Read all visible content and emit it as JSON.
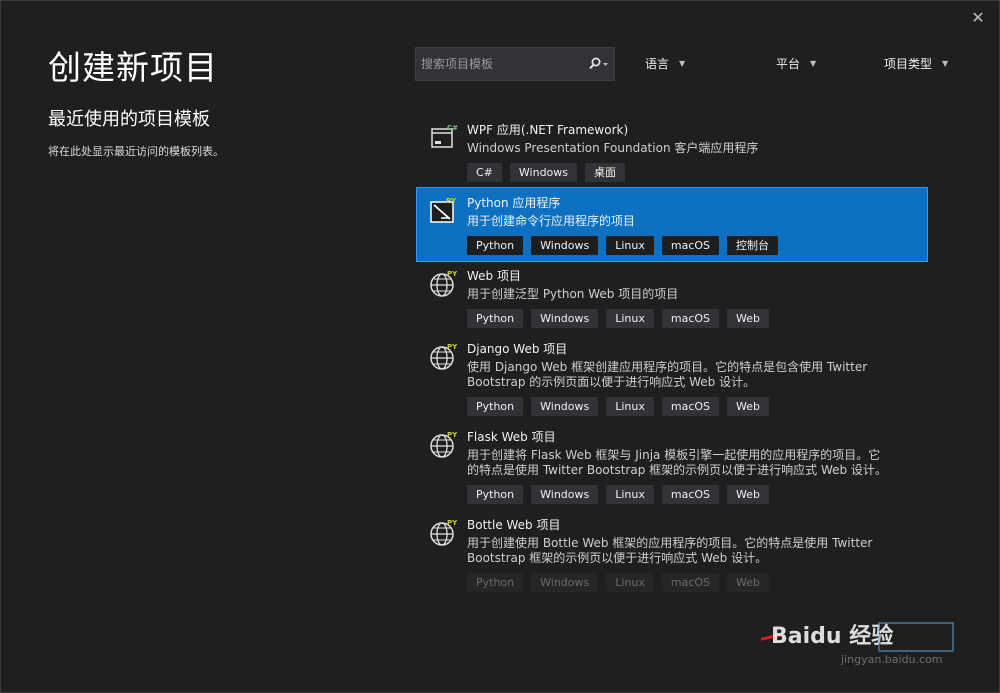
{
  "window": {
    "close_glyph": "✕"
  },
  "header": {
    "title": "创建新项目"
  },
  "recent": {
    "title": "最近使用的项目模板",
    "description": "将在此处显示最近访问的模板列表。"
  },
  "search": {
    "placeholder": "搜索项目模板",
    "value": ""
  },
  "filters": [
    {
      "label": "语言"
    },
    {
      "label": "平台"
    },
    {
      "label": "项目类型"
    }
  ],
  "templates": [
    {
      "title": "WPF 应用(.NET Framework)",
      "description": "Windows Presentation Foundation 客户端应用程序",
      "icon": "wpf-app-icon",
      "badge": "C#",
      "tags": [
        "C#",
        "Windows",
        "桌面"
      ]
    },
    {
      "title": "Python 应用程序",
      "description": "用于创建命令行应用程序的项目",
      "icon": "python-console-icon",
      "badge": "PY",
      "tags": [
        "Python",
        "Windows",
        "Linux",
        "macOS",
        "控制台"
      ]
    },
    {
      "title": "Web 项目",
      "description": "用于创建泛型 Python Web 项目的项目",
      "icon": "python-web-icon",
      "badge": "PY",
      "tags": [
        "Python",
        "Windows",
        "Linux",
        "macOS",
        "Web"
      ]
    },
    {
      "title": "Django Web 项目",
      "description": "使用 Django Web 框架创建应用程序的项目。它的特点是包含使用 Twitter Bootstrap 的示例页面以便于进行响应式 Web 设计。",
      "icon": "python-web-icon",
      "badge": "PY",
      "tags": [
        "Python",
        "Windows",
        "Linux",
        "macOS",
        "Web"
      ]
    },
    {
      "title": "Flask Web 项目",
      "description": "用于创建将 Flask Web 框架与 Jinja 模板引擎一起使用的应用程序的项目。它的特点是使用 Twitter Bootstrap 框架的示例页以便于进行响应式 Web 设计。",
      "icon": "python-web-icon",
      "badge": "PY",
      "tags": [
        "Python",
        "Windows",
        "Linux",
        "macOS",
        "Web"
      ]
    },
    {
      "title": "Bottle Web 项目",
      "description": "用于创建使用 Bottle Web 框架的应用程序的项目。它的特点是使用 Twitter Bootstrap 框架的示例页以便于进行响应式 Web 设计。",
      "icon": "python-web-icon",
      "badge": "PY",
      "tags": [
        "Python",
        "Windows",
        "Linux",
        "macOS",
        "Web"
      ]
    }
  ],
  "selected_index": 1,
  "watermark": {
    "text": "Baidu 经验",
    "subtext": "jingyan.baidu.com"
  },
  "colors": {
    "background": "#1f1f1f",
    "selected": "#0e70c0",
    "tag": "#333337",
    "badge_python": "#c9c93a",
    "badge_csharp": "#7ec17e"
  }
}
